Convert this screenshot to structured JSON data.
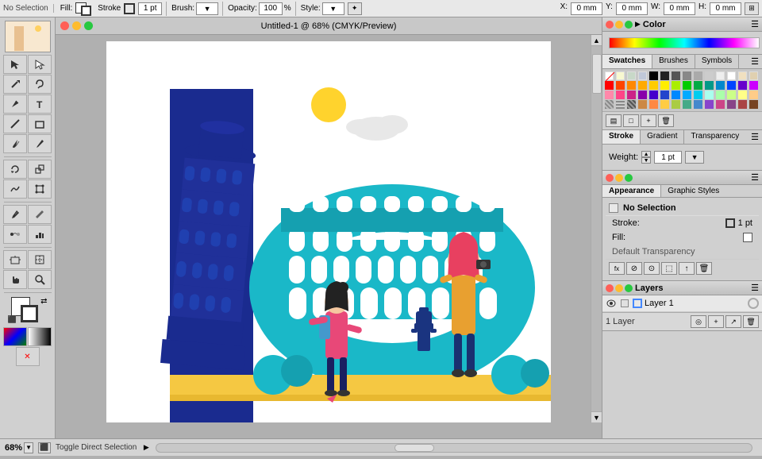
{
  "app": {
    "title": "Untitled-1 @ 68% (CMYK/Preview)",
    "zoom": "68%"
  },
  "toolbar": {
    "selection_label": "No Selection",
    "fill_label": "Fill:",
    "stroke_label": "Stroke",
    "brush_label": "Brush:",
    "opacity_label": "Opacity:",
    "opacity_value": "100",
    "style_label": "Style:",
    "x_label": "X:",
    "x_value": "0 mm",
    "y_label": "Y:",
    "y_value": "0 mm",
    "w_label": "W:",
    "w_value": "0 mm",
    "h_label": "H:",
    "h_value": "0 mm",
    "stroke_pt": "1 pt"
  },
  "panels": {
    "color": {
      "title": "Color"
    },
    "swatch_tabs": [
      "Swatches",
      "Brushes",
      "Symbols"
    ],
    "active_swatch_tab": "Swatches",
    "stroke": {
      "title": "Stroke",
      "tabs": [
        "Stroke",
        "Gradient",
        "Transparency"
      ],
      "active_tab": "Stroke",
      "weight_label": "Weight:",
      "weight_value": "1 pt"
    },
    "appearance": {
      "title": "Appearance",
      "tabs": [
        "Appearance",
        "Graphic Styles"
      ],
      "active_tab": "Appearance",
      "selection_label": "No Selection",
      "stroke_label": "Stroke:",
      "stroke_value": "1 pt",
      "fill_label": "Fill:",
      "default_label": "Default Transparency"
    },
    "layers": {
      "title": "Layers",
      "layer_name": "Layer 1",
      "count_label": "1 Layer"
    }
  },
  "status": {
    "zoom": "68%",
    "nav_label": "Toggle Direct Selection",
    "nav_arrow": "▶"
  }
}
